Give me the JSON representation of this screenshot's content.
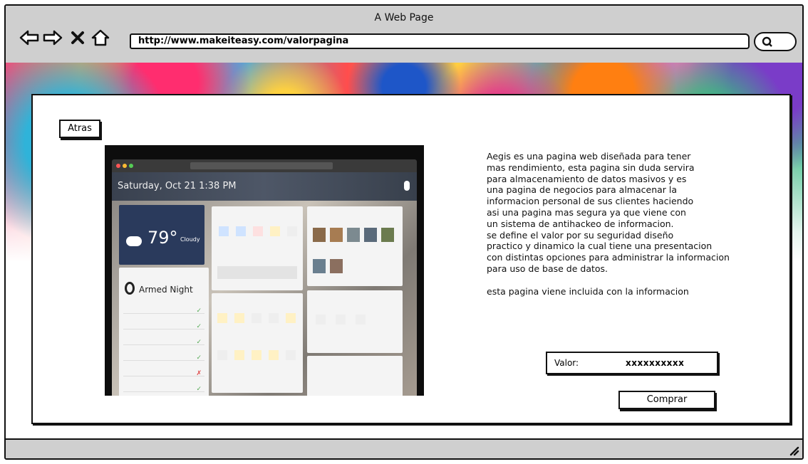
{
  "browser": {
    "title": "A Web Page",
    "url": "http://www.makeiteasy.com/valorpagina",
    "nav_icons": [
      "back-arrow-icon",
      "forward-arrow-icon",
      "close-x-icon",
      "home-icon"
    ],
    "search_icon": "search-icon"
  },
  "page": {
    "back_button": "Atras",
    "description": "Aegis es una pagina web diseñada para tener\nmas rendimiento, esta pagina sin duda servira\npara almacenamiento de datos masivos y es\nuna pagina de negocios para almacenar la\ninformacion personal de sus clientes haciendo\nasi una pagina mas segura ya que viene con\nun sistema de antihackeo de informacion.\nse define el valor por su seguridad diseño\npractico y dinamico la cual tiene una presentacion\ncon distintas opciones para administrar la informacion\npara uso de base de datos.\n\nesta pagina viene incluida con la informacion",
    "price_label": "Valor:",
    "price_value": "xxxxxxxxxx",
    "buy_button": "Comprar"
  },
  "screenshot": {
    "date": "Saturday, Oct 21  1:38 PM",
    "temperature": "79°",
    "condition": "Cloudy",
    "mode": "Armed Night",
    "colors": {
      "accent": "#f2b400",
      "sky": "#1b2a4a"
    }
  }
}
